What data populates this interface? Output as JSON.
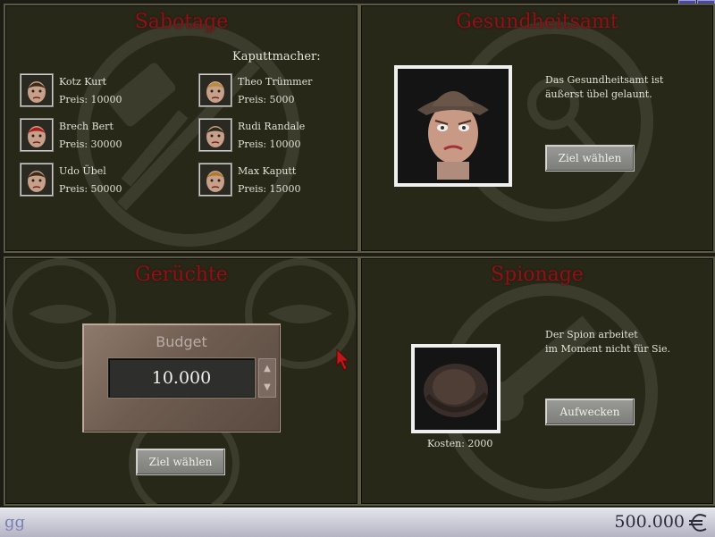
{
  "sabotage": {
    "title": "Sabotage",
    "heading": "Kaputtmacher:",
    "saboteurs": [
      {
        "name": "Kotz Kurt",
        "price": "Preis: 10000",
        "icon": "saboteur-portrait-icon",
        "hair": "#3a2a1a"
      },
      {
        "name": "Brech Bert",
        "price": "Preis: 30000",
        "icon": "saboteur-portrait-icon",
        "hair": "#b01a1a"
      },
      {
        "name": "Udo Übel",
        "price": "Preis: 50000",
        "icon": "saboteur-portrait-icon",
        "hair": "#3a2a1a"
      },
      {
        "name": "Theo Trümmer",
        "price": "Preis: 5000",
        "icon": "saboteur-portrait-icon",
        "hair": "#b88a3a"
      },
      {
        "name": "Rudi Randale",
        "price": "Preis: 10000",
        "icon": "saboteur-portrait-icon",
        "hair": "#2a2a1a"
      },
      {
        "name": "Max Kaputt",
        "price": "Preis: 15000",
        "icon": "saboteur-portrait-icon",
        "hair": "#b07a2a"
      }
    ]
  },
  "gesundheitsamt": {
    "title": "Gesundheitsamt",
    "text1": "Das Gesundheitsamt ist",
    "text2": "äußerst übel gelaunt.",
    "button": "Ziel wählen"
  },
  "geruechte": {
    "title": "Gerüchte",
    "budget_label": "Budget",
    "budget_value": "10.000",
    "button": "Ziel wählen"
  },
  "spionage": {
    "title": "Spionage",
    "text1": "Der Spion arbeitet",
    "text2": "im Moment nicht für Sie.",
    "cost": "Kosten: 2000",
    "button": "Aufwecken"
  },
  "statusbar": {
    "user": "gg",
    "money": "500.000"
  },
  "corner": {
    "help": "?",
    "exit": "|←"
  },
  "colors": {
    "title_red": "#8a1418",
    "panel_bg": "#272817"
  }
}
